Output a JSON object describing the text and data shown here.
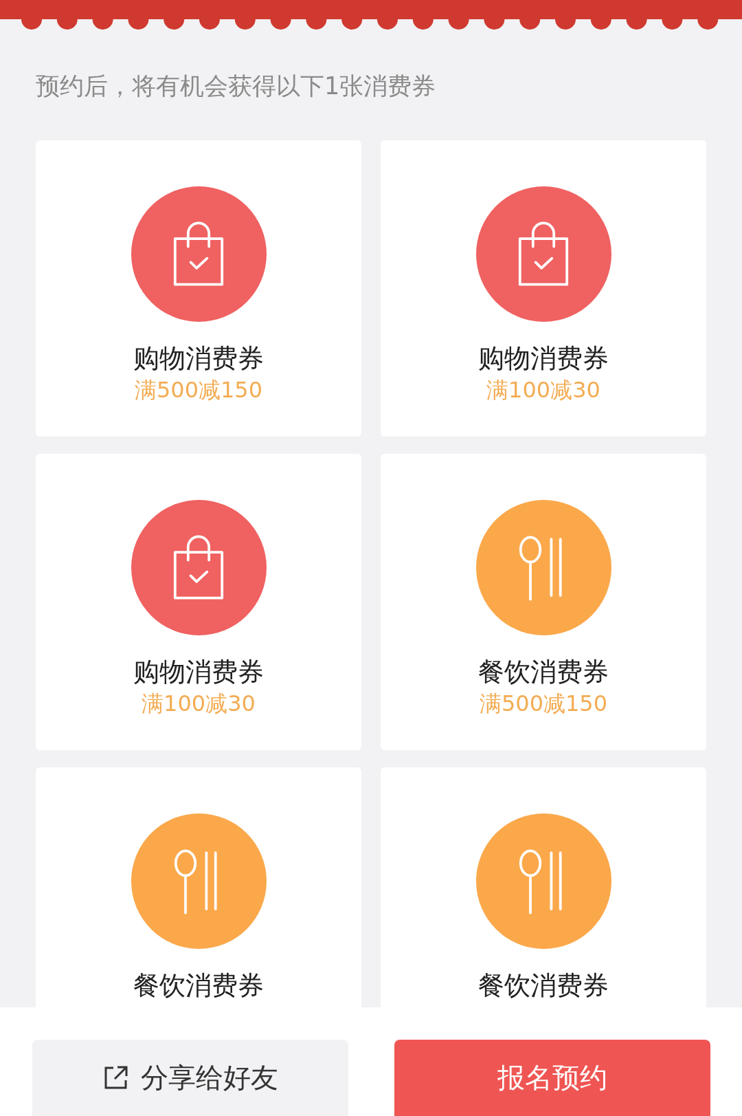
{
  "intro": "预约后，将有机会获得以下1张消费券",
  "coupons": [
    {
      "kind": "shopping",
      "title": "购物消费券",
      "value": "满500减150"
    },
    {
      "kind": "shopping",
      "title": "购物消费券",
      "value": "满100减30"
    },
    {
      "kind": "shopping",
      "title": "购物消费券",
      "value": "满100减30"
    },
    {
      "kind": "dining",
      "title": "餐饮消费券",
      "value": "满500减150"
    },
    {
      "kind": "dining",
      "title": "餐饮消费券"
    },
    {
      "kind": "dining",
      "title": "餐饮消费券"
    }
  ],
  "buttons": [
    {
      "kind": "share",
      "label": "分享给好友"
    },
    {
      "kind": "primary",
      "label": "报名预约"
    }
  ]
}
